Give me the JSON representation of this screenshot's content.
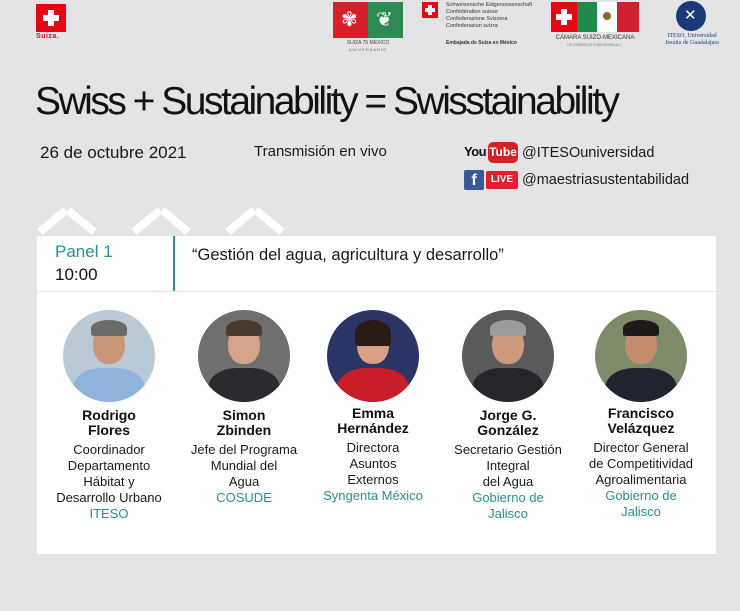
{
  "logos": {
    "suiza": "Suiza.",
    "anniversary": "SUIZA 75 MÉXICO",
    "anniversary_sub": "ANIVERSARIO",
    "embassy_lines": [
      "Schweizerische Eidgenossenschaft",
      "Confédération suisse",
      "Confederazione Svizzera",
      "Confederaziun svizra"
    ],
    "embassy_name": "Embajada de Suiza en México",
    "camara": "CÁMARA SUIZO-MEXICANA",
    "camara_sub": "DE COMERCIO E INDUSTRIA A.C.",
    "iteso_line1": "ITESO, Universidad",
    "iteso_line2": "Jesuita de Guadalajara"
  },
  "headline": "Swiss + Sustainability = Swisstainability",
  "date": "26 de octubre 2021",
  "live_label": "Transmisión en vivo",
  "youtube": {
    "you": "You",
    "tube": "Tube",
    "handle": "@ITESOuniversidad"
  },
  "facebook": {
    "icon": "f",
    "live": "LIVE",
    "handle": "@maestriasustentabilidad"
  },
  "panel": {
    "label": "Panel 1",
    "time": "10:00",
    "title": "“Gestión del agua, agricultura y desarrollo”"
  },
  "speakers": [
    {
      "name_1": "Rodrigo",
      "name_2": "Flores",
      "role": [
        "Coordinador",
        "Departamento",
        "Hábitat y",
        "Desarrollo Urbano"
      ],
      "org": [
        "ITESO"
      ]
    },
    {
      "name_1": "Simon",
      "name_2": "Zbinden",
      "role": [
        "Jefe del Programa",
        "Mundial del",
        "Agua"
      ],
      "org": [
        "COSUDE"
      ]
    },
    {
      "name_1": "Emma",
      "name_2": "Hernández",
      "role": [
        "Directora",
        "Asuntos",
        "Externos"
      ],
      "org": [
        "Syngenta México"
      ]
    },
    {
      "name_1": "Jorge G.",
      "name_2": "González",
      "role": [
        "Secretario Gestión",
        "Integral",
        "del Agua"
      ],
      "org": [
        "Gobierno de",
        "Jalisco"
      ]
    },
    {
      "name_1": "Francisco",
      "name_2": "Velázquez",
      "role": [
        "Director General",
        "de Competitividad",
        "Agroalimentaria"
      ],
      "org": [
        "Gobierno de",
        "Jalisco"
      ]
    }
  ],
  "colors": {
    "accent": "#2c8d95",
    "swiss_red": "#e30613",
    "background": "#e4e4e6"
  }
}
